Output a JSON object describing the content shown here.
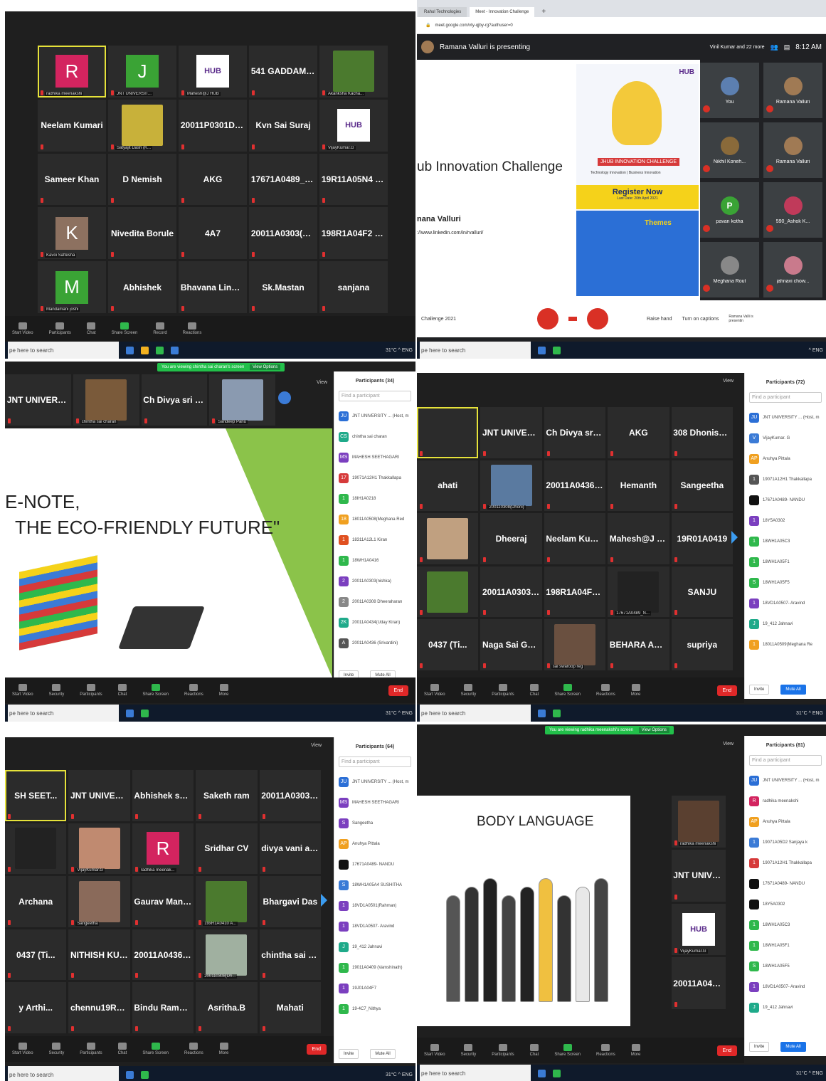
{
  "common": {
    "taskbar_search": "pe here to search",
    "tray": "31°C ^ ENG",
    "toolbar": [
      "Start Video",
      "Security",
      "Participants",
      "Chat",
      "Share Screen",
      "Reactions",
      "More"
    ],
    "end": "End",
    "view": "View",
    "invite": "Invite",
    "mute_all": "Mute All",
    "find_participant": "Find a participant"
  },
  "panel1": {
    "toolbar": [
      "Start Video",
      "Participants",
      "Chat",
      "Share Screen",
      "Record",
      "Reactions"
    ],
    "tiles": [
      {
        "n": "",
        "av": "R",
        "c": "#d3245f",
        "cap": "radhika meenakshi",
        "active": true
      },
      {
        "n": "",
        "av": "J",
        "c": "#3aa335",
        "cap": "JNT UNIVERSIT..."
      },
      {
        "n": "",
        "logo": "HUB",
        "cap": "Mahesh@J HUB"
      },
      {
        "n": "541 GADDAM P..."
      },
      {
        "n": "",
        "photo": "#4b7a2e",
        "cap": "Akanksha Kacha..."
      },
      {
        "n": "Neelam Kumari"
      },
      {
        "n": "",
        "photo": "#c8b13a",
        "cap": "Satyajit Dash (K..."
      },
      {
        "n": "20011P0301DIV..."
      },
      {
        "n": "Kvn Sai Suraj"
      },
      {
        "n": "",
        "logo": "HUB",
        "cap": "VijayKumar.G"
      },
      {
        "n": "Sameer Khan"
      },
      {
        "n": "D Nemish"
      },
      {
        "n": "AKG"
      },
      {
        "n": "17671A0489_N..."
      },
      {
        "n": "19R11A05N4 S..."
      },
      {
        "n": "",
        "av": "K",
        "c": "#8d7160",
        "cap": "Kavoi Saftesha"
      },
      {
        "n": "Nivedita Borule"
      },
      {
        "n": "4A7"
      },
      {
        "n": "20011A0303(ni..."
      },
      {
        "n": "198R1A04F2 Pr..."
      },
      {
        "n": "",
        "av": "M",
        "c": "#3aa335",
        "cap": "Mandamani joshi"
      },
      {
        "n": "Abhishek"
      },
      {
        "n": "Bhavana Linga..."
      },
      {
        "n": "Sk.Mastan"
      },
      {
        "n": "sanjana"
      }
    ]
  },
  "panel2": {
    "tabs": [
      "Rahul Technologies",
      "Meet - Innovation Challenge"
    ],
    "url": "meet.google.com/vty-qjby-rg?authuser=0",
    "presenting": "Ramana Valluri is presenting",
    "others": "Vinil Kumar and 22 more",
    "time": "8:12 AM",
    "slide_title": "ub Innovation Challenge",
    "slide_name": "nana Valluri",
    "slide_link": "://www.linkedin.com/in/rvalluri/",
    "poster_brand": "HUB",
    "poster_banner": "JHUB INNOVATION CHALLENGE",
    "poster_sub": "Technology Innovation | Business Innovation",
    "register": "Register Now",
    "register_date": "Last Date: 20th April 2021",
    "themes": "Themes",
    "meeting": "Challenge 2021",
    "people": [
      {
        "n": "You",
        "c": "#5c7fb0"
      },
      {
        "n": "Ramana Valluri",
        "c": "#a07a54"
      },
      {
        "n": "Nikhil Koneh...",
        "c": "#8a6a3a"
      },
      {
        "n": "Ramana Valluri",
        "c": "#a07a54"
      },
      {
        "n": "pavan kotha",
        "c": "#3aa335",
        "av": "P"
      },
      {
        "n": "590_Ashok K...",
        "c": "#c03a5a"
      },
      {
        "n": "Meghana Rout",
        "c": "#888"
      },
      {
        "n": "jahnavi chow...",
        "c": "#c97a8c"
      }
    ],
    "controls": [
      "Raise hand",
      "Turn on captions",
      "Ramana Valli is presentin"
    ]
  },
  "panel3": {
    "banner": "You are viewing chintha sai charan's screen",
    "view_options": "View Options",
    "strip": [
      {
        "n": "JNT UNIVERSIT..."
      },
      {
        "n": "",
        "photo": "#7a5a3a",
        "cap": "chintha sai charan"
      },
      {
        "n": "Ch Divya sri (18..."
      },
      {
        "n": "",
        "photo": "#8a9ab0",
        "cap": "Sandeep Panu"
      }
    ],
    "slide_line1": "E-NOTE,",
    "slide_line2": "THE ECO-FRIENDLY FUTURE\"",
    "participants_title": "Participants (34)",
    "participants": [
      {
        "n": "JNT UNIVERSITY ... (Host, m",
        "c": "#2b6fd6",
        "a": "JU"
      },
      {
        "n": "chintha sai charan",
        "c": "#1faa8a",
        "a": "CS"
      },
      {
        "n": "MAHESH SEETHAGARI",
        "c": "#7b3fbf",
        "a": "MS"
      },
      {
        "n": "19071A12H1 Thakkallapa",
        "c": "#d63a3a",
        "a": "17"
      },
      {
        "n": "18IH1A0218",
        "c": "#2fb84c",
        "a": "1"
      },
      {
        "n": "18011A0508(Meghana Red",
        "c": "#f0a020",
        "a": "18"
      },
      {
        "n": "18311A12L1 Kiran",
        "c": "#e05020",
        "a": "1"
      },
      {
        "n": "18WH1A0416",
        "c": "#2fb84c",
        "a": "1"
      },
      {
        "n": "20011A0303(nishka)",
        "c": "#7b3fbf",
        "a": "2"
      },
      {
        "n": "20011A0308 Dheeraharan",
        "c": "#888",
        "a": "2"
      },
      {
        "n": "20011A0434(Uday Kiran)",
        "c": "#1faa8a",
        "a": "2K"
      },
      {
        "n": "20011A0436 (Srivardini)",
        "c": "#555",
        "a": "A"
      }
    ]
  },
  "panel4": {
    "participants_title": "Participants (72)",
    "tiles": [
      {
        "n": "",
        "active": true
      },
      {
        "n": "JNT UNIVERSIT..."
      },
      {
        "n": "Ch Divya sri (18..."
      },
      {
        "n": "AKG"
      },
      {
        "n": "308 Dhonishara..."
      },
      {
        "n": "ahati"
      },
      {
        "n": "",
        "photo": "#5a7aa0",
        "cap": "200110308(Dhoni)"
      },
      {
        "n": "20011A0436 (Sr..."
      },
      {
        "n": "Hemanth"
      },
      {
        "n": "Sangeetha"
      },
      {
        "n": "",
        "photo": "#c0a080"
      },
      {
        "n": "Dheeraj"
      },
      {
        "n": "Neelam Kumari"
      },
      {
        "n": "Mahesh@J HUB"
      },
      {
        "n": "19R01A0419"
      },
      {
        "n": "",
        "photo": "#4b7a2e"
      },
      {
        "n": "20011A0303(ni..."
      },
      {
        "n": "198R1A04F2 Pr..."
      },
      {
        "n": "",
        "photo": "#222",
        "cap": "17671A0489_N..."
      },
      {
        "n": "SANJU"
      },
      {
        "n": "0437 (Ti..."
      },
      {
        "n": "Naga Sai Garika..."
      },
      {
        "n": "",
        "photo": "#6a5040",
        "cap": "sai swaroop reg"
      },
      {
        "n": "BEHARA AMULYA"
      },
      {
        "n": "supriya"
      }
    ],
    "participants": [
      {
        "n": "JNT UNIVERSITY ... (Host, m",
        "c": "#2b6fd6",
        "a": "JU"
      },
      {
        "n": "VijayKumar. G",
        "c": "#3b7bd6",
        "a": "V"
      },
      {
        "n": "Anuhya Pittala",
        "c": "#f0a020",
        "a": "AP"
      },
      {
        "n": "19071A12H1 Thakkallapa",
        "c": "#555",
        "a": "1"
      },
      {
        "n": "17671A0489- NANDU",
        "c": "#111",
        "a": ""
      },
      {
        "n": "18Y5A0302",
        "c": "#7b3fbf",
        "a": "1"
      },
      {
        "n": "18WH1A05C3",
        "c": "#2fb84c",
        "a": "1"
      },
      {
        "n": "18WH1A05F1",
        "c": "#2fb84c",
        "a": "1"
      },
      {
        "n": "18WH1A05F5",
        "c": "#2fb84c",
        "a": "S"
      },
      {
        "n": "18VD1A0507- Aravind",
        "c": "#7b3fbf",
        "a": "1"
      },
      {
        "n": "19_412 Jahnavi",
        "c": "#1faa8a",
        "a": "J"
      },
      {
        "n": "18011A0509(Meghana Re",
        "c": "#f0a020",
        "a": "1"
      }
    ]
  },
  "panel5": {
    "participants_title": "Participants (64)",
    "tiles": [
      {
        "n": "SH SEET...",
        "active": true
      },
      {
        "n": "JNT UNIVERSIT..."
      },
      {
        "n": "Abhishek sukka"
      },
      {
        "n": "Saketh ram"
      },
      {
        "n": "20011A0303(ni..."
      },
      {
        "n": "",
        "photo": "#222"
      },
      {
        "n": "",
        "photo": "#c08a70",
        "cap": "VijayKumar.G"
      },
      {
        "n": "",
        "av": "R",
        "c": "#d3245f",
        "cap": "radhika meenak..."
      },
      {
        "n": "Sridhar CV"
      },
      {
        "n": "divya vani abburi"
      },
      {
        "n": "Archana"
      },
      {
        "n": "",
        "photo": "#8a6a5a",
        "cap": "Sangeetha"
      },
      {
        "n": "Gaurav Mandal..."
      },
      {
        "n": "",
        "photo": "#4b7a2e",
        "cap": "19xR1A0410 A..."
      },
      {
        "n": "Bhargavi Das"
      },
      {
        "n": "0437 (Ti..."
      },
      {
        "n": "NITHISH KUMAR"
      },
      {
        "n": "20011A0436 (Sr..."
      },
      {
        "n": "",
        "photo": "#a0b0a0",
        "cap": "200110308(Dh..."
      },
      {
        "n": "chintha sai char..."
      },
      {
        "n": "y Arthi..."
      },
      {
        "n": "chennu19R01A..."
      },
      {
        "n": "Bindu Ramya 1..."
      },
      {
        "n": "Asritha.B"
      },
      {
        "n": "Mahati"
      }
    ],
    "participants": [
      {
        "n": "JNT UNIVERSITY ... (Host, m",
        "c": "#2b6fd6",
        "a": "JU"
      },
      {
        "n": "MAHESH SEETHAGARI",
        "c": "#7b3fbf",
        "a": "MS"
      },
      {
        "n": "Sangeetha",
        "c": "#7b3fbf",
        "a": "S"
      },
      {
        "n": "Anuhya Pittala",
        "c": "#f0a020",
        "a": "AP"
      },
      {
        "n": "17671A0489- NANDU",
        "c": "#111",
        "a": ""
      },
      {
        "n": "18WH1A05A4 SUSHITHA",
        "c": "#3b7bd6",
        "a": "S"
      },
      {
        "n": "18VD1A0501(Rahman)",
        "c": "#7b3fbf",
        "a": "1"
      },
      {
        "n": "18VD1A0507- Aravind",
        "c": "#7b3fbf",
        "a": "1"
      },
      {
        "n": "19_412 Jahnavi",
        "c": "#1faa8a",
        "a": "J"
      },
      {
        "n": "19011A0409 (Vamshinath)",
        "c": "#2fb84c",
        "a": "1"
      },
      {
        "n": "19J01A04F7",
        "c": "#7b3fbf",
        "a": "1"
      },
      {
        "n": "19-4C7_Nithya",
        "c": "#2fb84c",
        "a": "1"
      }
    ]
  },
  "panel6": {
    "banner": "You are viewing radhika meenakshi's screen",
    "view_options": "View Options",
    "participants_title": "Participants (81)",
    "slide_title": "BODY LANGUAGE",
    "strip": [
      {
        "n": "",
        "photo": "#5a4030",
        "cap": "radhika meenakshi"
      },
      {
        "n": "JNT UNIVERSIT..."
      },
      {
        "n": "",
        "logo": "HUB",
        "cap": "VijayKumar.G"
      },
      {
        "n": "20011A0436 (Sr..."
      }
    ],
    "participants": [
      {
        "n": "JNT UNIVERSITY ... (Host, m",
        "c": "#2b6fd6",
        "a": "JU"
      },
      {
        "n": "radhika meenakshi",
        "c": "#d3245f",
        "a": "R"
      },
      {
        "n": "Anuhya Pittala",
        "c": "#f0a020",
        "a": "AP"
      },
      {
        "n": "19071A05D2 Sanjaya k",
        "c": "#3b7bd6",
        "a": "1"
      },
      {
        "n": "19071A12H1 Thakkallapa",
        "c": "#d63a3a",
        "a": "1"
      },
      {
        "n": "17671A0489- NANDU",
        "c": "#111",
        "a": ""
      },
      {
        "n": "18Y5A0302",
        "c": "#111",
        "a": ""
      },
      {
        "n": "18WH1A05C3",
        "c": "#2fb84c",
        "a": "1"
      },
      {
        "n": "18WH1A05F1",
        "c": "#2fb84c",
        "a": "1"
      },
      {
        "n": "18WH1A05F5",
        "c": "#2fb84c",
        "a": "S"
      },
      {
        "n": "18VD1A0507- Aravind",
        "c": "#7b3fbf",
        "a": "1"
      },
      {
        "n": "19_412 Jahnavi",
        "c": "#1faa8a",
        "a": "J"
      }
    ]
  }
}
